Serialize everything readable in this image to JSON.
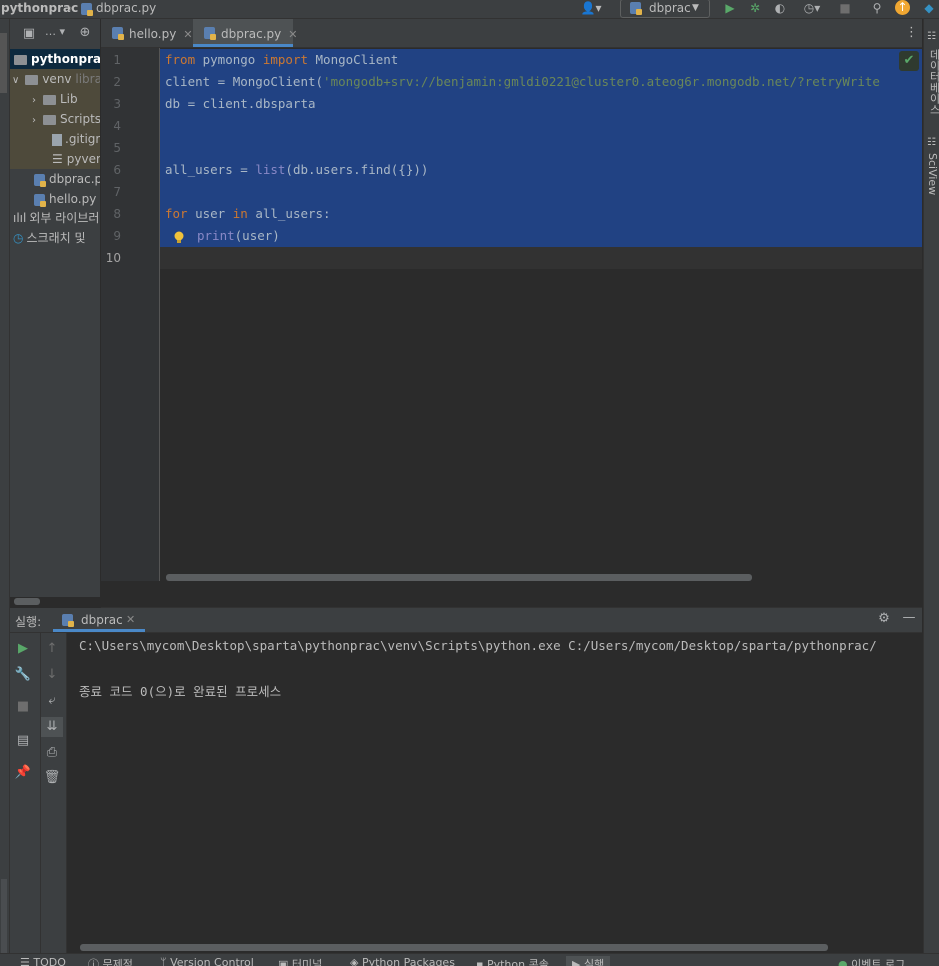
{
  "breadcrumb": {
    "project": "pythonprac",
    "file": "dbprac.py"
  },
  "toolbar": {
    "run_config": "dbprac"
  },
  "project_tree": {
    "root": "pythonprac",
    "venv": "venv",
    "venv_hint": "librar",
    "lib": "Lib",
    "scripts": "Scripts",
    "gitignore": ".gitign",
    "pyvenv": "pyven",
    "dbprac": "dbprac.py",
    "hello": "hello.py",
    "external_libs": "외부 라이브러",
    "scratches": "스크래치 및"
  },
  "tabs": [
    {
      "label": "hello.py"
    },
    {
      "label": "dbprac.py"
    }
  ],
  "editor": {
    "line_numbers": [
      "1",
      "2",
      "3",
      "4",
      "5",
      "6",
      "7",
      "8",
      "9",
      "10"
    ],
    "code": {
      "l1": {
        "kw1": "from",
        "mod": " pymongo ",
        "kw2": "import",
        "name": " MongoClient"
      },
      "l2": {
        "pre": "client = MongoClient(",
        "str": "'mongodb+srv://benjamin:gmldi0221@cluster0.ateog6r.mongodb.net/?retryWrite"
      },
      "l3": "db = client.dbsparta",
      "l6": {
        "pre": "all_users = ",
        "bi": "list",
        "post": "(db.users.find({}))"
      },
      "l8": {
        "kw1": "for",
        "mid": " user ",
        "kw2": "in",
        "post": " all_users:"
      },
      "l9": {
        "bi": "print",
        "post": "(user)"
      }
    }
  },
  "right_tools": {
    "database": "데이터베이스",
    "sciview": "SciView"
  },
  "run_panel": {
    "label": "실행:",
    "tab": "dbprac",
    "console_lines": [
      "C:\\Users\\mycom\\Desktop\\sparta\\pythonprac\\venv\\Scripts\\python.exe C:/Users/mycom/Desktop/sparta/pythonprac/",
      "종료 코드 0(으)로 완료된 프로세스"
    ]
  },
  "statusbar": {
    "todo": "TODO",
    "problems": "문제점",
    "vcs": "Version Control",
    "terminal": "터미널",
    "packages": "Python Packages",
    "console": "Python 콘솔",
    "run": "실행",
    "event_log": "이벤트 로그"
  }
}
